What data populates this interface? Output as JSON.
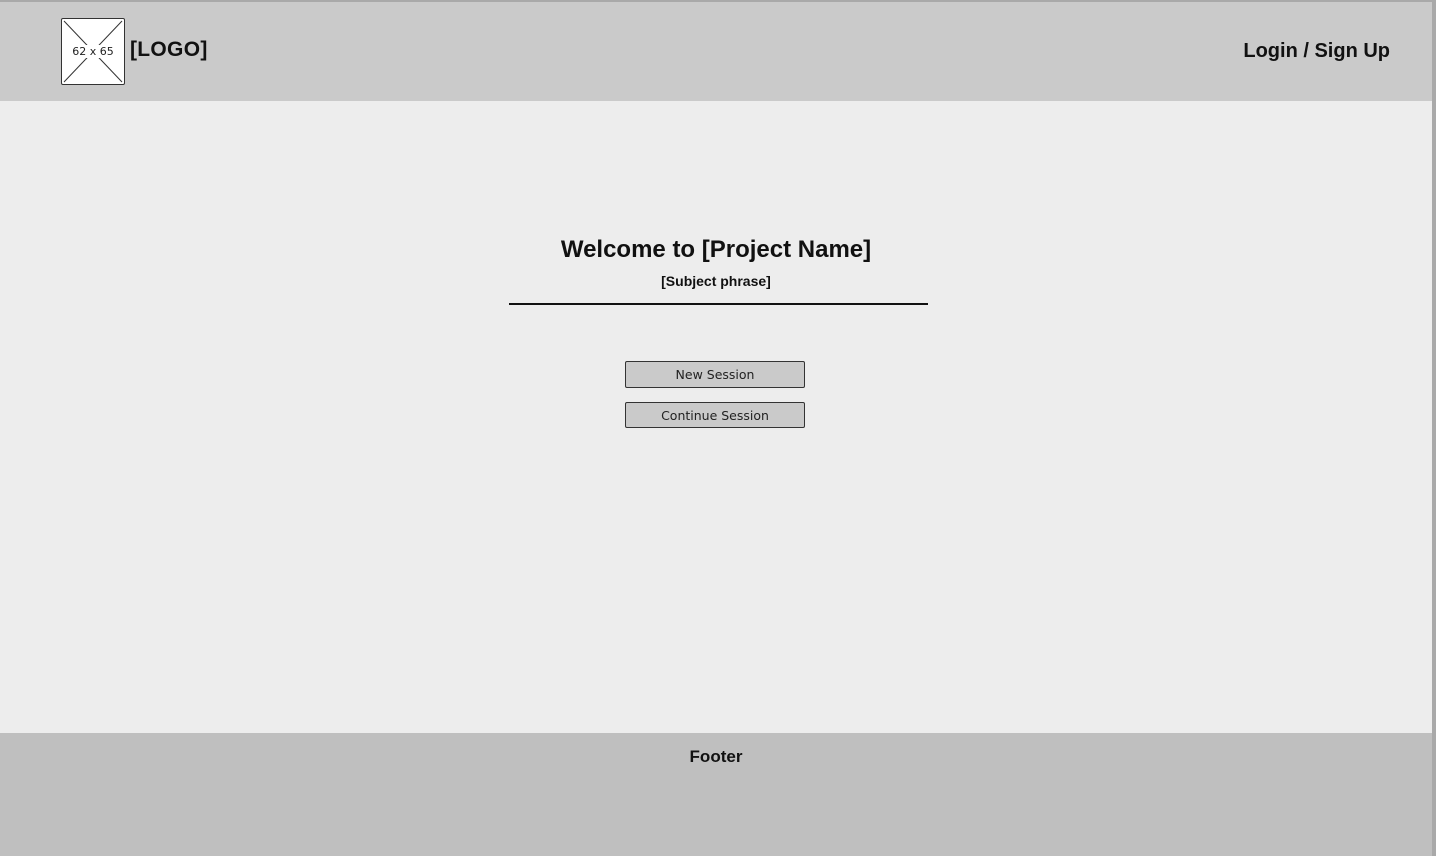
{
  "header": {
    "logo_placeholder_label": "62 x 65",
    "logo_text": "[LOGO]",
    "login_link": "Login / Sign Up"
  },
  "main": {
    "title": "Welcome to [Project Name]",
    "subtitle": "[Subject phrase]",
    "buttons": {
      "new_session": "New Session",
      "continue_session": "Continue Session"
    }
  },
  "footer": {
    "text": "Footer"
  },
  "colors": {
    "header_bg": "#cacaca",
    "main_bg": "#ededed",
    "footer_bg": "#bfbfbf",
    "button_bg": "#cacaca"
  }
}
